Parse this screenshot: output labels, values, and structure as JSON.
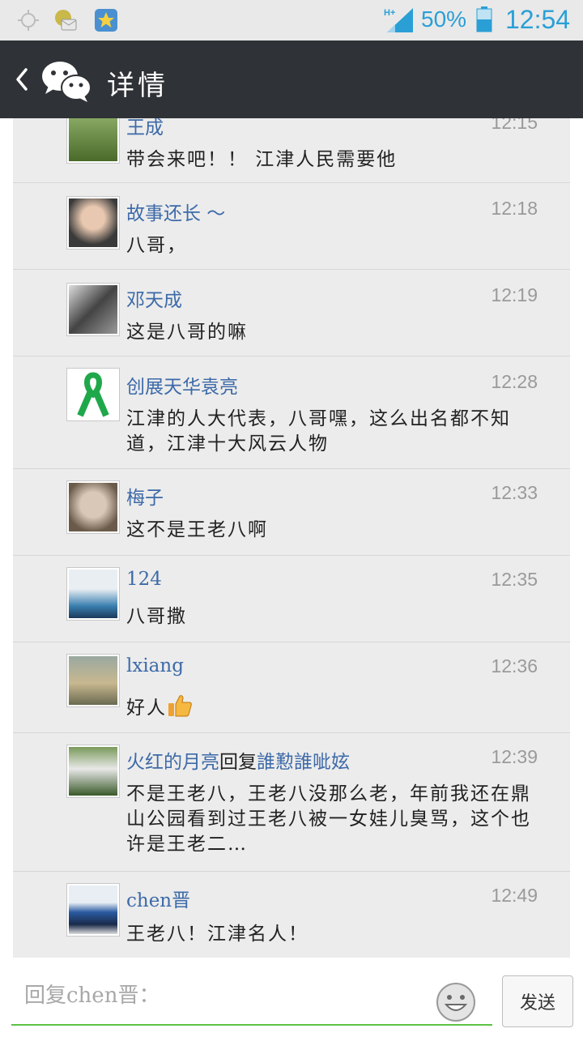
{
  "status_bar": {
    "icons": [
      "gps-icon",
      "mail-icon",
      "star-app-icon"
    ],
    "network": "H+",
    "battery_percent": "50%",
    "time": "12:54"
  },
  "header": {
    "title": "详情",
    "back_icon": "chevron-left-icon",
    "logo_icon": "wechat-logo-icon"
  },
  "comments": [
    {
      "name": "王成",
      "time": "12:15",
      "text": "带会来吧！！ 江津人民需要他",
      "avatar_color": "#6b8a4a"
    },
    {
      "name": "故事还长 〜",
      "time": "12:18",
      "text": "八哥，",
      "avatar_color": "#c99f8a"
    },
    {
      "name": "邓天成",
      "time": "12:19",
      "text": "这是八哥的嘛",
      "avatar_color": "#666666"
    },
    {
      "name": "创展天华袁亮",
      "time": "12:28",
      "text": "江津的人大代表，八哥嘿，这么出名都不知道，江津十大风云人物",
      "avatar_color": "#1fa84a"
    },
    {
      "name": "梅子",
      "time": "12:33",
      "text": "这不是王老八啊",
      "avatar_color": "#a89585"
    },
    {
      "name": "124",
      "time": "12:35",
      "text": "八哥撒",
      "avatar_color": "#3a7fb0"
    },
    {
      "name": "lxiang",
      "time": "12:36",
      "text": "好人",
      "avatar_color": "#8a8a70",
      "thumbs_up": true
    },
    {
      "name": "火红的月亮",
      "reply_word": "回复",
      "reply_to": "誰懃誰呲妶",
      "time": "12:39",
      "text": "不是王老八，王老八没那么老，年前我还在鼎山公园看到过王老八被一女娃儿臭骂，这个也许是王老二…",
      "avatar_color": "#5a7a3a"
    },
    {
      "name": "chen晋",
      "time": "12:49",
      "text": "王老八！江津名人！",
      "avatar_color": "#2a5aa0"
    }
  ],
  "input": {
    "placeholder": "回复chen晋：",
    "emoji_icon": "smiley-icon",
    "send_label": "发送"
  },
  "colors": {
    "header_bg": "#2f3236",
    "name_blue": "#3d6aa8",
    "status_blue": "#2a9fd6",
    "input_underline": "#5cc244"
  }
}
